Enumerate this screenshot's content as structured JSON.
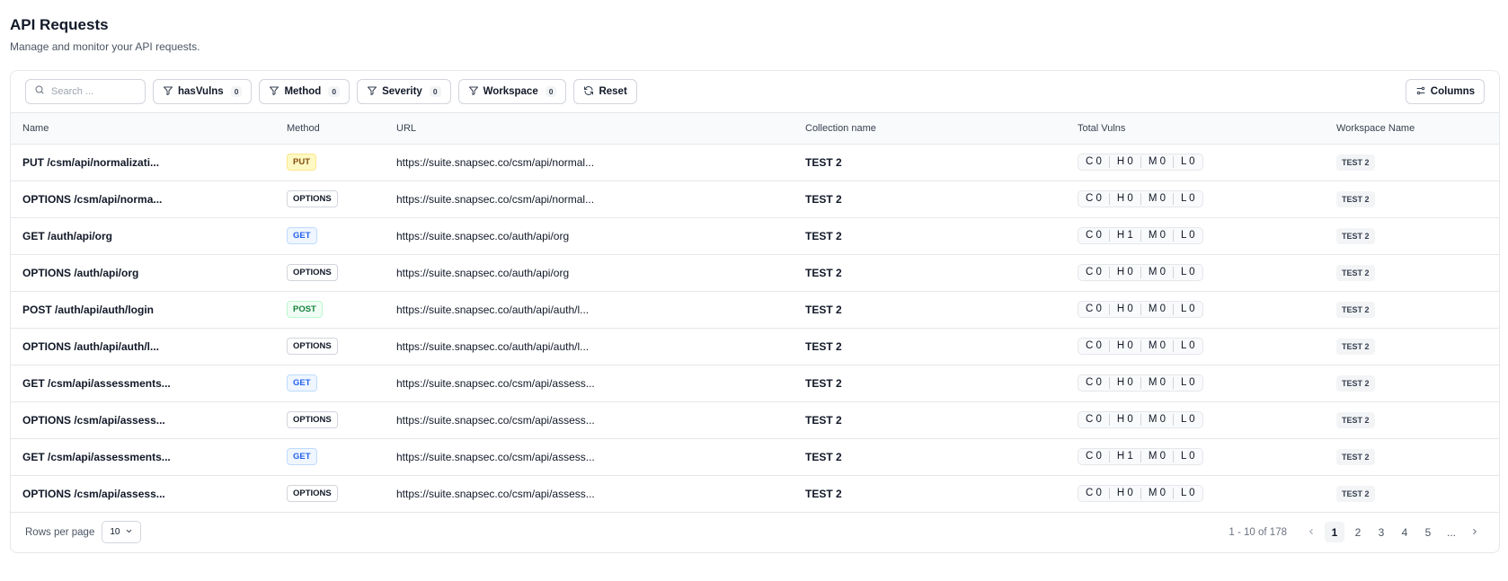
{
  "header": {
    "title": "API Requests",
    "subtitle": "Manage and monitor your API requests."
  },
  "toolbar": {
    "search_placeholder": "Search ...",
    "filters": [
      {
        "label": "hasVulns",
        "count": "0"
      },
      {
        "label": "Method",
        "count": "0"
      },
      {
        "label": "Severity",
        "count": "0"
      },
      {
        "label": "Workspace",
        "count": "0"
      }
    ],
    "reset_label": "Reset",
    "columns_label": "Columns"
  },
  "table": {
    "columns": [
      "Name",
      "Method",
      "URL",
      "Collection name",
      "Total Vulns",
      "Workspace Name"
    ],
    "rows": [
      {
        "name": "PUT /csm/api/normalizati...",
        "method": "PUT",
        "url": "https://suite.snapsec.co/csm/api/normal...",
        "collection": "TEST 2",
        "c": "C 0",
        "h": "H 0",
        "m": "M 0",
        "l": "L 0",
        "workspace": "TEST 2"
      },
      {
        "name": "OPTIONS /csm/api/norma...",
        "method": "OPTIONS",
        "url": "https://suite.snapsec.co/csm/api/normal...",
        "collection": "TEST 2",
        "c": "C 0",
        "h": "H 0",
        "m": "M 0",
        "l": "L 0",
        "workspace": "TEST 2"
      },
      {
        "name": "GET /auth/api/org",
        "method": "GET",
        "url": "https://suite.snapsec.co/auth/api/org",
        "collection": "TEST 2",
        "c": "C 0",
        "h": "H 1",
        "m": "M 0",
        "l": "L 0",
        "workspace": "TEST 2"
      },
      {
        "name": "OPTIONS /auth/api/org",
        "method": "OPTIONS",
        "url": "https://suite.snapsec.co/auth/api/org",
        "collection": "TEST 2",
        "c": "C 0",
        "h": "H 0",
        "m": "M 0",
        "l": "L 0",
        "workspace": "TEST 2"
      },
      {
        "name": "POST /auth/api/auth/login",
        "method": "POST",
        "url": "https://suite.snapsec.co/auth/api/auth/l...",
        "collection": "TEST 2",
        "c": "C 0",
        "h": "H 0",
        "m": "M 0",
        "l": "L 0",
        "workspace": "TEST 2"
      },
      {
        "name": "OPTIONS /auth/api/auth/l...",
        "method": "OPTIONS",
        "url": "https://suite.snapsec.co/auth/api/auth/l...",
        "collection": "TEST 2",
        "c": "C 0",
        "h": "H 0",
        "m": "M 0",
        "l": "L 0",
        "workspace": "TEST 2"
      },
      {
        "name": "GET /csm/api/assessments...",
        "method": "GET",
        "url": "https://suite.snapsec.co/csm/api/assess...",
        "collection": "TEST 2",
        "c": "C 0",
        "h": "H 0",
        "m": "M 0",
        "l": "L 0",
        "workspace": "TEST 2"
      },
      {
        "name": "OPTIONS /csm/api/assess...",
        "method": "OPTIONS",
        "url": "https://suite.snapsec.co/csm/api/assess...",
        "collection": "TEST 2",
        "c": "C 0",
        "h": "H 0",
        "m": "M 0",
        "l": "L 0",
        "workspace": "TEST 2"
      },
      {
        "name": "GET /csm/api/assessments...",
        "method": "GET",
        "url": "https://suite.snapsec.co/csm/api/assess...",
        "collection": "TEST 2",
        "c": "C 0",
        "h": "H 1",
        "m": "M 0",
        "l": "L 0",
        "workspace": "TEST 2"
      },
      {
        "name": "OPTIONS /csm/api/assess...",
        "method": "OPTIONS",
        "url": "https://suite.snapsec.co/csm/api/assess...",
        "collection": "TEST 2",
        "c": "C 0",
        "h": "H 0",
        "m": "M 0",
        "l": "L 0",
        "workspace": "TEST 2"
      }
    ]
  },
  "footer": {
    "rows_per_page_label": "Rows per page",
    "rows_per_page_value": "10",
    "range_text": "1 - 10 of 178",
    "pages": [
      "1",
      "2",
      "3",
      "4",
      "5",
      "..."
    ],
    "active_page": "1"
  },
  "colors": {
    "put": "#fef9c3",
    "get": "#eff6ff",
    "post": "#f0fdf4",
    "border": "#e5e7eb"
  },
  "icons": {
    "search": "search-icon",
    "filter": "filter-icon",
    "reset": "refresh-icon",
    "columns": "sliders-icon",
    "chevron": "chevron-down-icon",
    "prev": "chevron-left-icon",
    "next": "chevron-right-icon"
  }
}
